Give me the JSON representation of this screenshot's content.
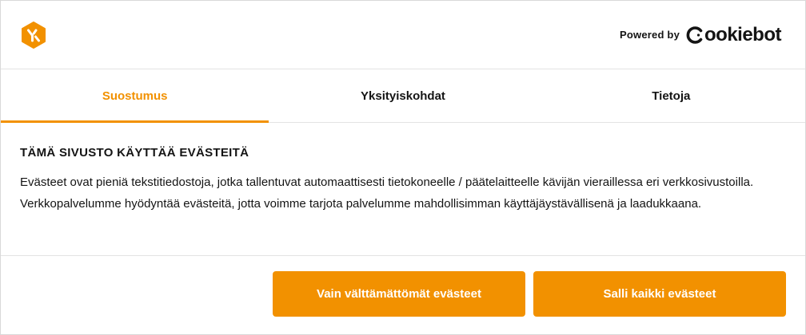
{
  "header": {
    "logo_icon": "brand-hexagon-logo-icon",
    "powered_label": "Powered by",
    "brand_name": "ookiebot",
    "brand_initial": "C"
  },
  "tabs": [
    {
      "label": "Suostumus",
      "active": true
    },
    {
      "label": "Yksityiskohdat",
      "active": false
    },
    {
      "label": "Tietoja",
      "active": false
    }
  ],
  "content": {
    "title": "TÄMÄ SIVUSTO KÄYTTÄÄ EVÄSTEITÄ",
    "text": "Evästeet ovat pieniä tekstitiedostoja, jotka tallentuvat automaattisesti tietokoneelle / päätelaitteelle kävijän vieraillessa eri verkkosivustoilla. Verkkopalvelumme hyödyntää evästeitä, jotta voimme tarjota palvelumme mahdollisimman käyttäjäystävällisenä ja laadukkaana."
  },
  "buttons": {
    "necessary_label": "Vain välttämättömät evästeet",
    "allow_all_label": "Salli kaikki evästeet"
  },
  "colors": {
    "accent": "#f29100",
    "text": "#141414",
    "divider": "#e3e3e3"
  }
}
